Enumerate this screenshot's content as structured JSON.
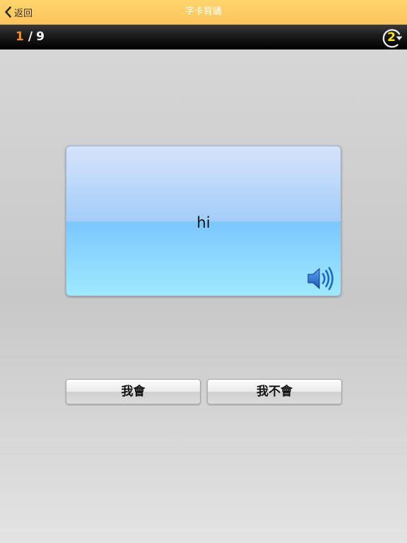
{
  "nav": {
    "back_label": "返回",
    "title": "字卡背誦"
  },
  "progress": {
    "current": "1",
    "separator": "/",
    "total": "9",
    "replay_count": "2"
  },
  "card": {
    "word": "hi"
  },
  "actions": {
    "know_label": "我會",
    "dont_know_label": "我不會"
  },
  "icons": {
    "back": "chevron-left-icon",
    "replay": "replay-arrow-icon",
    "speaker": "speaker-icon"
  },
  "colors": {
    "nav_bar": "#fbc45d",
    "progress_bar": "#000000",
    "current_index": "#f6911d",
    "replay_count": "#ffe400",
    "speaker": "#1c67c9"
  }
}
